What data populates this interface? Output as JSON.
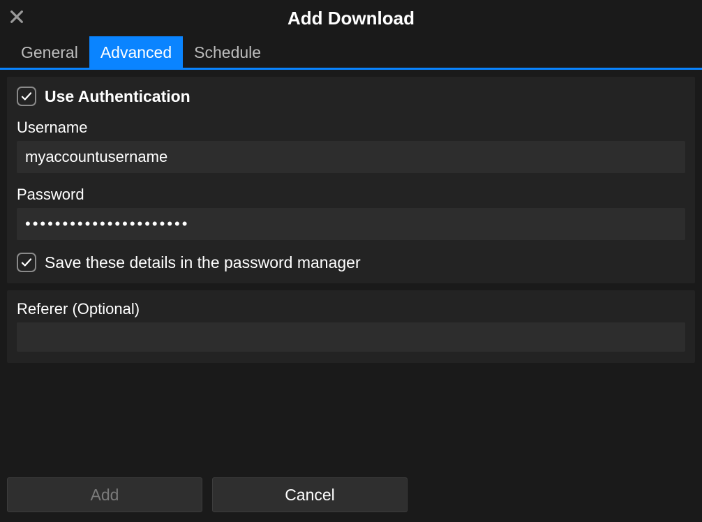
{
  "title": "Add Download",
  "tabs": {
    "general": "General",
    "advanced": "Advanced",
    "schedule": "Schedule",
    "active": "advanced"
  },
  "auth": {
    "use_auth_label": "Use Authentication",
    "use_auth_checked": true,
    "username_label": "Username",
    "username_value": "myaccountusername",
    "password_label": "Password",
    "password_value": "••••••••••••••••••••••",
    "save_details_label": "Save these details in the password manager",
    "save_details_checked": true
  },
  "referer": {
    "label": "Referer (Optional)",
    "value": ""
  },
  "buttons": {
    "add": "Add",
    "cancel": "Cancel"
  }
}
